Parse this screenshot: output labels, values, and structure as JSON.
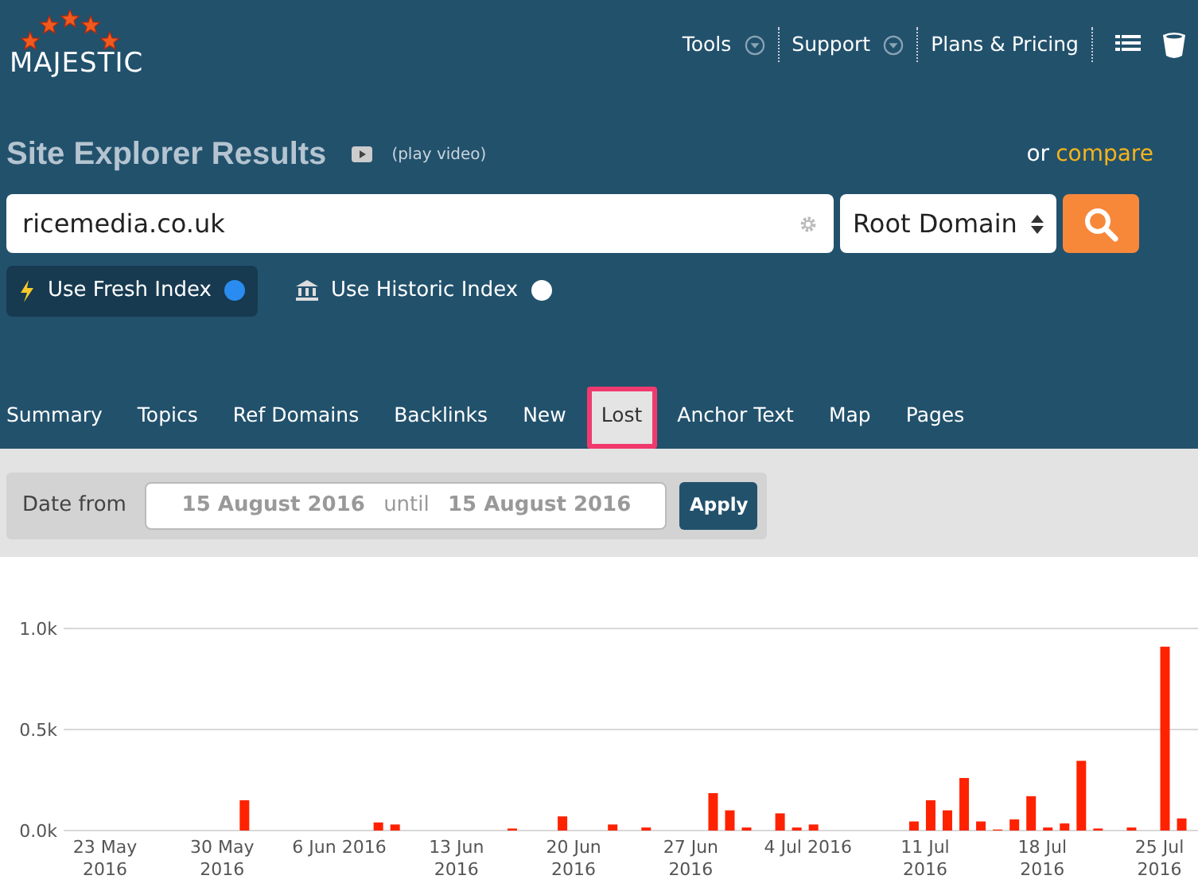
{
  "brand": {
    "name": "MAJESTIC"
  },
  "top_nav": [
    {
      "label": "Tools",
      "dropdown": true
    },
    {
      "label": "Support",
      "dropdown": true
    },
    {
      "label": "Plans & Pricing",
      "dropdown": false
    }
  ],
  "header": {
    "title": "Site Explorer Results",
    "video_link": "(play video)",
    "or_text": "or",
    "compare_link": "compare"
  },
  "search": {
    "value": "ricemedia.co.uk",
    "scope": "Root Domain"
  },
  "index_options": [
    {
      "label": "Use Fresh Index",
      "selected": true,
      "kind": "fresh"
    },
    {
      "label": "Use Historic Index",
      "selected": false,
      "kind": "historic"
    }
  ],
  "tabs": [
    {
      "label": "Summary",
      "selected": false
    },
    {
      "label": "Topics",
      "selected": false
    },
    {
      "label": "Ref Domains",
      "selected": false
    },
    {
      "label": "Backlinks",
      "selected": false
    },
    {
      "label": "New",
      "selected": false
    },
    {
      "label": "Lost",
      "selected": true
    },
    {
      "label": "Anchor Text",
      "selected": false
    },
    {
      "label": "Map",
      "selected": false
    },
    {
      "label": "Pages",
      "selected": false
    }
  ],
  "date_filter": {
    "label": "Date from",
    "from": "15 August 2016",
    "until_text": "until",
    "to": "15 August 2016",
    "apply": "Apply"
  },
  "chart_data": {
    "type": "bar",
    "categories": [
      "23 May 2016",
      null,
      null,
      null,
      null,
      null,
      null,
      "30 May 2016",
      null,
      null,
      null,
      null,
      null,
      null,
      "6 Jun 2016",
      null,
      null,
      null,
      null,
      null,
      null,
      "13 Jun 2016",
      null,
      null,
      null,
      null,
      null,
      null,
      "20 Jun 2016",
      null,
      null,
      null,
      null,
      null,
      null,
      "27 Jun 2016",
      null,
      null,
      null,
      null,
      null,
      null,
      "4 Jul 2016",
      null,
      null,
      null,
      null,
      null,
      null,
      "11 Jul 2016",
      null,
      null,
      null,
      null,
      null,
      null,
      "18 Jul 2016",
      null,
      null,
      null,
      null,
      null,
      null,
      "25 Jul 2016",
      null
    ],
    "series": [
      {
        "color": "#ff2200",
        "values": [
          0,
          0,
          0,
          0,
          0,
          0,
          0,
          0,
          150,
          0,
          0,
          0,
          0,
          0,
          0,
          0,
          40,
          30,
          0,
          0,
          0,
          0,
          0,
          0,
          10,
          0,
          0,
          70,
          0,
          0,
          30,
          0,
          15,
          0,
          0,
          0,
          185,
          100,
          15,
          0,
          85,
          15,
          30,
          0,
          0,
          0,
          0,
          0,
          45,
          150,
          100,
          260,
          45,
          5,
          55,
          170,
          15,
          35,
          345,
          10,
          0,
          15,
          0,
          910,
          60
        ]
      }
    ],
    "ylim": [
      0,
      1000
    ],
    "yticks": [
      {
        "value": 0,
        "label": "0.0k"
      },
      {
        "value": 500,
        "label": "0.5k"
      },
      {
        "value": 1000,
        "label": "1.0k"
      }
    ]
  }
}
